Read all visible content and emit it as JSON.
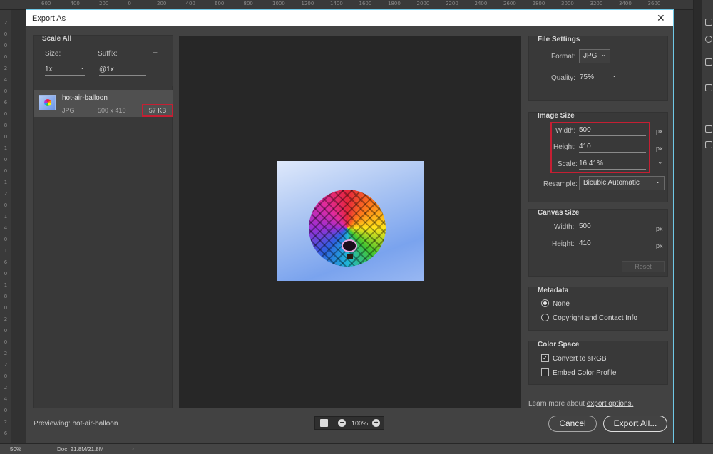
{
  "ruler_top": [
    "600",
    "400",
    "200",
    "0",
    "200",
    "400",
    "600",
    "800",
    "1000",
    "1200",
    "1400",
    "1600",
    "1800",
    "2000",
    "2200",
    "2400",
    "2600",
    "2800",
    "3000",
    "3200",
    "3400",
    "3600"
  ],
  "ruler_left": [
    "2",
    "0",
    "0",
    "0",
    "2",
    "4",
    "0",
    "6",
    "0",
    "8",
    "0",
    "1",
    "0",
    "0",
    "1",
    "2",
    "0",
    "1",
    "4",
    "0",
    "1",
    "6",
    "0",
    "1",
    "8",
    "0",
    "2",
    "0",
    "0",
    "2",
    "2",
    "0",
    "2",
    "4",
    "0",
    "2",
    "6",
    "0"
  ],
  "status": {
    "zoom": "50%",
    "doc": "Doc: 21.8M/21.8M",
    "arrow": "›"
  },
  "dialog": {
    "title": "Export As",
    "close": "✕"
  },
  "scale_all": {
    "header": "Scale All",
    "size_label": "Size:",
    "suffix_label": "Suffix:",
    "add_icon": "+",
    "size_value": "1x",
    "suffix_value": "@1x"
  },
  "asset": {
    "name": "hot-air-balloon",
    "format": "JPG",
    "dims": "500 x 410",
    "filesize": "57 KB"
  },
  "preview": {
    "zoom": "100%",
    "minus": "−",
    "plus": "+",
    "previewing": "Previewing: hot-air-balloon"
  },
  "file_settings": {
    "header": "File Settings",
    "format_label": "Format:",
    "format_value": "JPG",
    "quality_label": "Quality:",
    "quality_value": "75%"
  },
  "image_size": {
    "header": "Image Size",
    "width_label": "Width:",
    "width_value": "500",
    "height_label": "Height:",
    "height_value": "410",
    "scale_label": "Scale:",
    "scale_value": "16.41%",
    "unit": "px",
    "resample_label": "Resample:",
    "resample_value": "Bicubic Automatic"
  },
  "canvas_size": {
    "header": "Canvas Size",
    "width_label": "Width:",
    "width_value": "500",
    "height_label": "Height:",
    "height_value": "410",
    "unit": "px",
    "reset": "Reset"
  },
  "metadata": {
    "header": "Metadata",
    "none": "None",
    "copyright": "Copyright and Contact Info"
  },
  "color_space": {
    "header": "Color Space",
    "srgb": "Convert to sRGB",
    "embed": "Embed Color Profile",
    "check_mark": "✓"
  },
  "footer": {
    "learn_prefix": "Learn more about",
    "learn_link": "export options.",
    "cancel": "Cancel",
    "export_all": "Export All..."
  }
}
